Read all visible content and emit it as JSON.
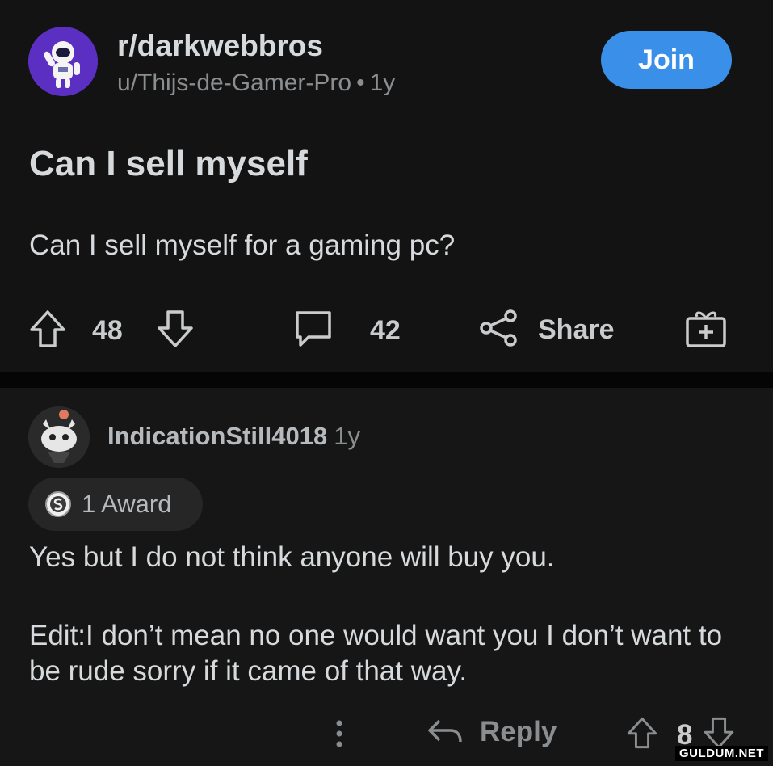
{
  "post": {
    "subreddit": "r/darkwebbros",
    "author": "u/Thijs-de-Gamer-Pro",
    "separator": "•",
    "age": "1y",
    "join_label": "Join",
    "title": "Can I sell myself",
    "body": "Can I sell myself for a gaming pc?",
    "votes": "48",
    "comments": "42",
    "share_label": "Share"
  },
  "comment": {
    "author": "IndicationStill4018",
    "age": "1y",
    "award_label": "1 Award",
    "text_line1": "Yes but I do not think anyone will buy you.",
    "text_line2": "Edit:I don’t mean no one would want you I don’t want to be rude sorry if it came of that way.",
    "reply_label": "Reply",
    "votes": "8"
  },
  "watermark": "GULDUM.NET",
  "colors": {
    "background": "#131313",
    "join_button": "#3a8fe8",
    "subreddit_avatar": "#5a2fc2",
    "muted_text": "#8b8e90"
  }
}
